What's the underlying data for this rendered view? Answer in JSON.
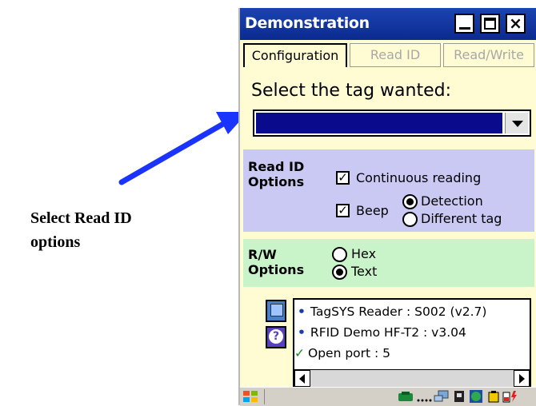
{
  "annotation": {
    "text_line1": "Select Read ID",
    "text_line2": "options"
  },
  "window": {
    "title": "Demonstration",
    "buttons": {
      "close_glyph": "×"
    }
  },
  "tabs": [
    {
      "label": "Configuration",
      "active": true
    },
    {
      "label": "Read ID",
      "active": false
    },
    {
      "label": "Read/Write",
      "active": false
    }
  ],
  "tag_select": {
    "label": "Select the tag wanted:",
    "value": ""
  },
  "read_id_options": {
    "title_line1": "Read ID",
    "title_line2": "Options",
    "continuous_reading": {
      "label": "Continuous reading",
      "checked": true
    },
    "beep": {
      "label": "Beep",
      "checked": true
    },
    "beep_mode": [
      {
        "label": "Detection",
        "selected": true
      },
      {
        "label": "Different tag",
        "selected": false
      }
    ]
  },
  "rw_options": {
    "title_line1": "R/W",
    "title_line2": "Options",
    "format": [
      {
        "label": "Hex",
        "selected": false
      },
      {
        "label": "Text",
        "selected": true
      }
    ]
  },
  "info": {
    "lines": [
      "TagSYS Reader : S002 (v2.7)",
      "RFID Demo HF-T2 : v3.04",
      "Open port : 5"
    ],
    "check_glyph": "✓",
    "bullet_glyph": "•"
  },
  "colors": {
    "titlebar": "#1c43b2",
    "window_bg": "#fffcd3",
    "read_panel": "#c9c9f4",
    "rw_panel": "#c9f4c9",
    "select_fill": "#0a0a8c",
    "arrow": "#1a33ff"
  },
  "icons": [
    "start-flag-icon",
    "phone-icon",
    "network-icon",
    "sim-icon",
    "globe-icon",
    "battery-icon",
    "power-icon",
    "reader-device-icon",
    "help-icon"
  ]
}
